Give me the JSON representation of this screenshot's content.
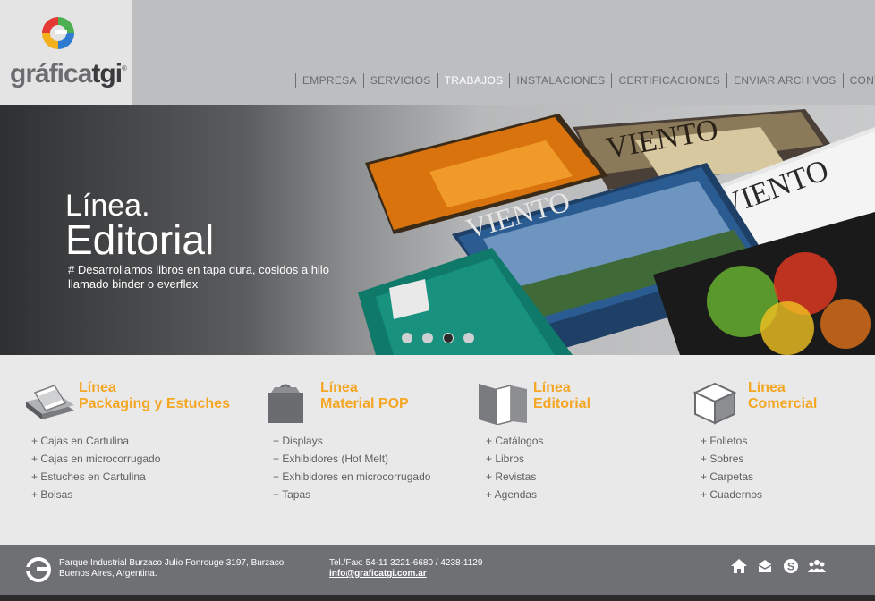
{
  "header": {
    "logo_text_a": "gráfica",
    "logo_text_b": "tgi",
    "logo_reg": "®",
    "nav": [
      {
        "label": "EMPRESA",
        "active": false
      },
      {
        "label": "SERVICIOS",
        "active": false
      },
      {
        "label": "TRABAJOS",
        "active": true
      },
      {
        "label": "INSTALACIONES",
        "active": false
      },
      {
        "label": "CERTIFICACIONES",
        "active": false
      },
      {
        "label": "ENVIAR ARCHIVOS",
        "active": false
      },
      {
        "label": "CONTACTO",
        "active": false
      }
    ]
  },
  "banner": {
    "title_line1": "Línea.",
    "title_line2": "Editorial",
    "description": "# Desarrollamos libros en tapa dura, cosidos a hilo llamado binder o everflex",
    "slides": 4,
    "active_slide": 3
  },
  "products": [
    {
      "title1": "Línea",
      "title2": "Packaging y Estuches",
      "icon": "packaging-icon",
      "items": [
        "+ Cajas en Cartulina",
        "+ Cajas en microcorrugado",
        "+ Estuches en Cartulina",
        "+ Bolsas"
      ]
    },
    {
      "title1": "Línea",
      "title2": "Material POP",
      "icon": "pop-box-icon",
      "items": [
        "+ Displays",
        "+ Exhibidores (Hot Melt)",
        "+ Exhibidores en microcorrugado",
        "+ Tapas"
      ]
    },
    {
      "title1": "Línea",
      "title2": "Editorial",
      "icon": "folder-icon",
      "items": [
        "+ Catálogos",
        "+ Libros",
        "+ Revistas",
        "+ Agendas"
      ]
    },
    {
      "title1": "Línea",
      "title2": "Comercial",
      "icon": "cube-icon",
      "items": [
        "+ Folletos",
        "+ Sobres",
        "+ Carpetas",
        "+ Cuadernos"
      ]
    }
  ],
  "footer": {
    "address_line1": "Parque Industrial Burzaco Julio Fonrouge 3197, Burzaco",
    "address_line2": "Buenos Aires, Argentina.",
    "tel": "Tel./Fax: 54-11 3221-6680 / 4238-1129",
    "email": "info@graficatgi.com.ar",
    "icons": [
      "home-icon",
      "mail-icon",
      "skype-icon",
      "group-icon"
    ]
  },
  "colors": {
    "accent": "#f5a623",
    "header_bg": "#bdbec0",
    "footer_bg": "#6f7073"
  }
}
